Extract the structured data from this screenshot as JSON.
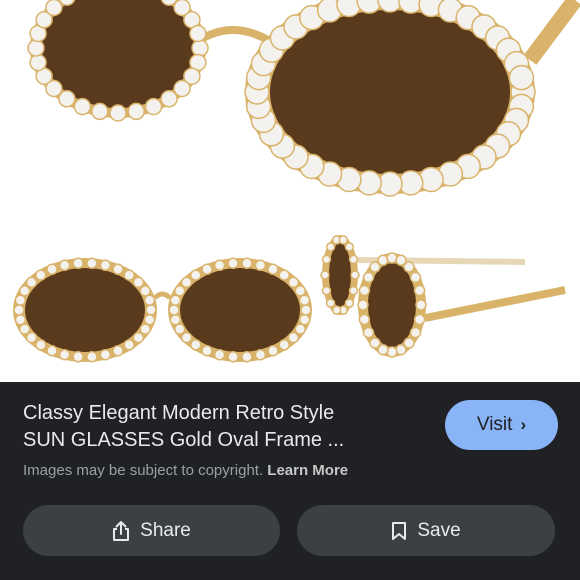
{
  "image": {
    "subject": "sunglasses-photo",
    "colors": {
      "frame": "#d9b36a",
      "lens": "#5a3a1c",
      "crystal": "#f4f2ee"
    }
  },
  "result": {
    "title_line1": "Classy Elegant Modern Retro Style",
    "title_line2": "SUN GLASSES Gold Oval Frame ...",
    "visit_label": "Visit",
    "copyright_text": "Images may be subject to copyright.",
    "learn_more": "Learn More"
  },
  "actions": {
    "share_label": "Share",
    "save_label": "Save",
    "share_icon": "share-icon",
    "save_icon": "bookmark-icon"
  },
  "colors": {
    "panel_bg": "#202124",
    "visit_bg": "#8ab4f8",
    "button_bg": "#3c4043"
  }
}
